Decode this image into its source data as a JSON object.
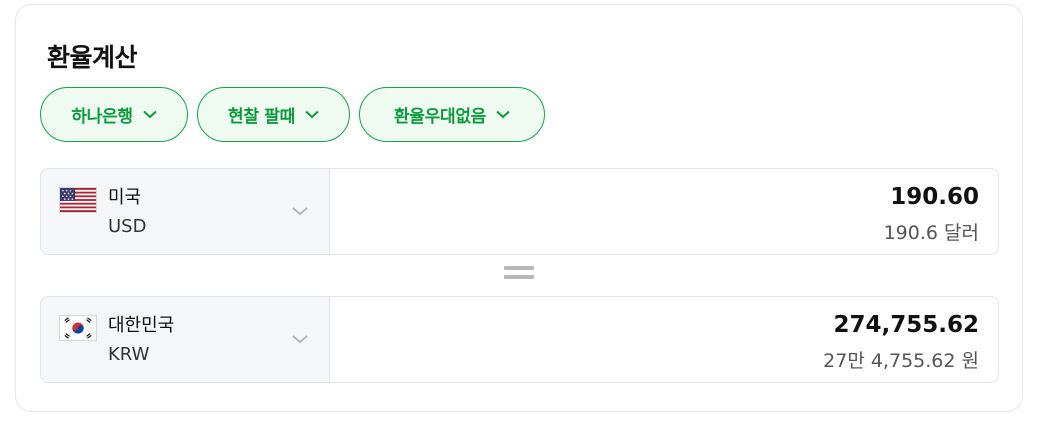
{
  "widget": {
    "title": "환율계산"
  },
  "filters": [
    {
      "label": "하나은행",
      "icon": "chevron-down-icon"
    },
    {
      "label": "현찰 팔때",
      "icon": "chevron-down-icon"
    },
    {
      "label": "환율우대없음",
      "icon": "chevron-down-icon"
    }
  ],
  "from": {
    "flag": "us-flag-icon",
    "country": "미국",
    "code": "USD",
    "amount": "190.60",
    "amount_text": "190.6 달러"
  },
  "to": {
    "flag": "kr-flag-icon",
    "country": "대한민국",
    "code": "KRW",
    "amount": "274,755.62",
    "amount_text": "27만 4,755.62 원"
  },
  "colors": {
    "accent": "#0c9a3e",
    "chip_bg": "#effaf1",
    "chip_border": "#16a34a"
  }
}
